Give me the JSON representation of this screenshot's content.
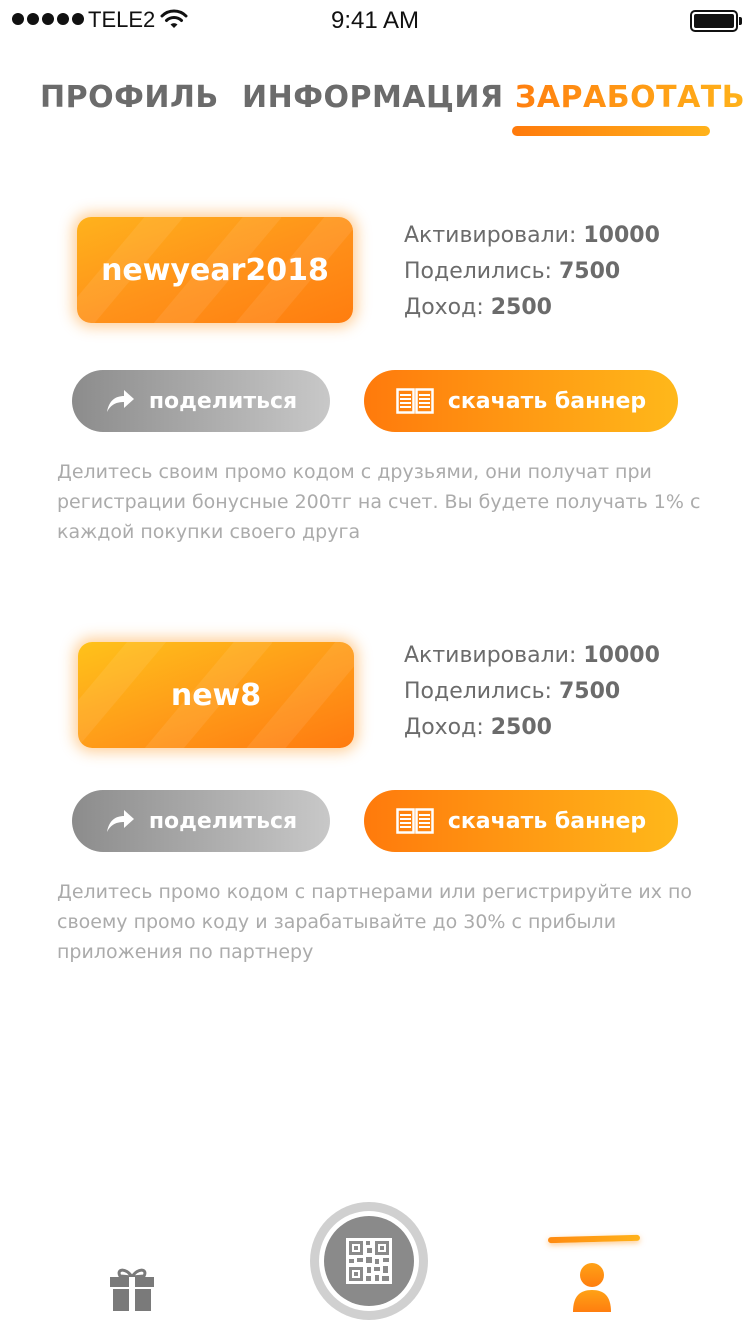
{
  "status_bar": {
    "carrier": "TELE2",
    "time": "9:41 AM",
    "icons": [
      "signal-dots-icon",
      "wifi-icon",
      "battery-icon"
    ]
  },
  "tabs": [
    {
      "label": "ПРОФИЛЬ",
      "active": false
    },
    {
      "label": "ИНФОРМАЦИЯ",
      "active": false
    },
    {
      "label": "ЗАРАБОТАТЬ",
      "active": true
    }
  ],
  "promos": [
    {
      "code": "newyear2018",
      "stats": [
        {
          "label": "Активировали:",
          "value": "10000"
        },
        {
          "label": "Поделились:",
          "value": "7500"
        },
        {
          "label": "Доход:",
          "value": "2500"
        }
      ],
      "share_label": "поделиться",
      "banner_label": "скачать баннер",
      "description": "Делитесь своим промо кодом с друзьями, они получат при регистрации бонусные 200тг на счет. Вы будете получать 1% с каждой покупки своего друга"
    },
    {
      "code": "new8",
      "stats": [
        {
          "label": "Активировали:",
          "value": "10000"
        },
        {
          "label": "Поделились:",
          "value": "7500"
        },
        {
          "label": "Доход:",
          "value": "2500"
        }
      ],
      "share_label": "поделиться",
      "banner_label": "скачать баннер",
      "description": "Делитесь промо кодом с партнерами или регистрируйте их по своему промо коду и зарабатывайте до 30% с прибыли приложения по партнеру"
    }
  ],
  "bottom_nav": {
    "items": [
      "gift-icon",
      "qr-code-icon",
      "user-icon"
    ],
    "active": "user-icon"
  },
  "colors": {
    "accent_start": "#ff7a0c",
    "accent_end": "#ffb81a",
    "text_gray": "#6b6b6b",
    "desc_gray": "#ababab"
  }
}
